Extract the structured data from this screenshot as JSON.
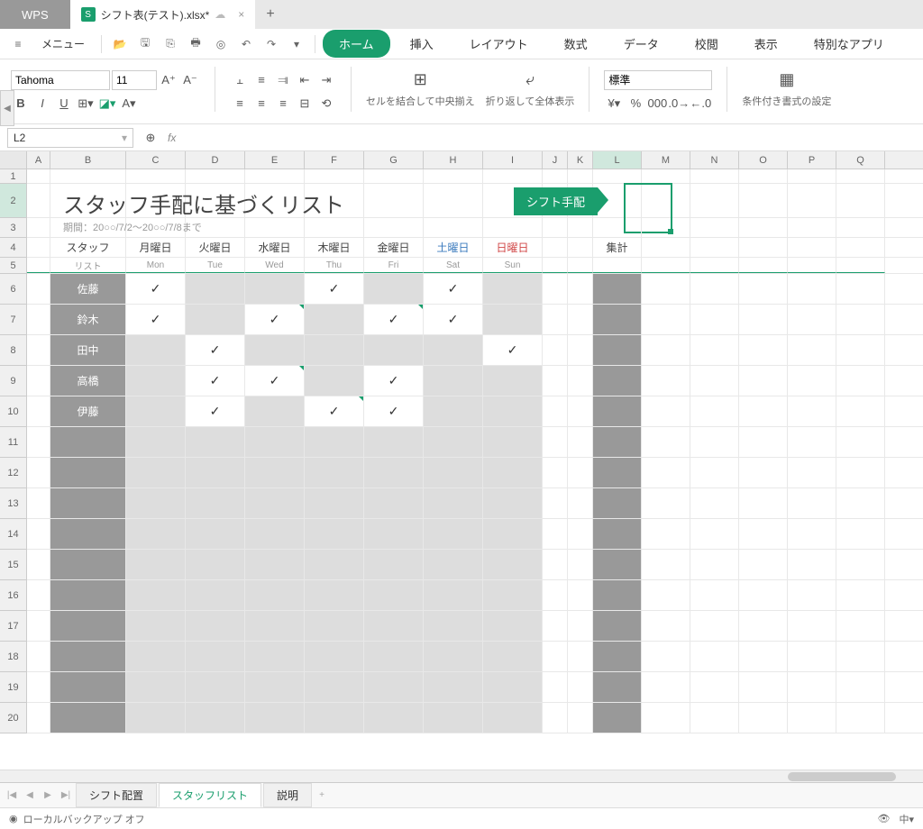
{
  "app": {
    "name": "WPS"
  },
  "document": {
    "name": "シフト表(テスト).xlsx*",
    "cloud_icon": "☁"
  },
  "menu": {
    "label": "メニュー"
  },
  "tabs": {
    "home": "ホーム",
    "insert": "挿入",
    "layout": "レイアウト",
    "formula": "数式",
    "data": "データ",
    "review": "校閲",
    "view": "表示",
    "special": "特別なアプリ"
  },
  "ribbon": {
    "font_name": "Tahoma",
    "font_size": "11",
    "merge_label": "セルを結合して中央揃え",
    "wrap_label": "折り返して全体表示",
    "format_value": "標準",
    "cond_fmt": "条件付き書式の設定"
  },
  "namebox": {
    "value": "L2",
    "fx": "fx"
  },
  "cols": [
    "A",
    "B",
    "C",
    "D",
    "E",
    "F",
    "G",
    "H",
    "I",
    "J",
    "K",
    "L",
    "M",
    "N",
    "O",
    "P",
    "Q"
  ],
  "sheet": {
    "title": "スタッフ手配に基づくリスト",
    "subtitle": "期間：20○○/7/2～20○○/7/8まで",
    "shift_btn": "シフト手配",
    "staff_hdr1": "スタッフ",
    "staff_hdr2": "リスト",
    "total_hdr": "集計",
    "days": [
      {
        "jp": "月曜日",
        "en": "Mon"
      },
      {
        "jp": "火曜日",
        "en": "Tue"
      },
      {
        "jp": "水曜日",
        "en": "Wed"
      },
      {
        "jp": "木曜日",
        "en": "Thu"
      },
      {
        "jp": "金曜日",
        "en": "Fri"
      },
      {
        "jp": "土曜日",
        "en": "Sat",
        "cls": "sat"
      },
      {
        "jp": "日曜日",
        "en": "Sun",
        "cls": "sun"
      }
    ],
    "staff": [
      {
        "name": "佐藤",
        "marks": [
          "✓",
          "",
          "",
          "✓",
          "",
          "✓",
          ""
        ]
      },
      {
        "name": "鈴木",
        "marks": [
          "✓",
          "",
          "✓",
          "",
          "✓",
          "✓",
          ""
        ]
      },
      {
        "name": "田中",
        "marks": [
          "",
          "✓",
          "",
          "",
          "",
          "",
          "✓"
        ]
      },
      {
        "name": "高橋",
        "marks": [
          "",
          "✓",
          "✓",
          "",
          "✓",
          "",
          ""
        ]
      },
      {
        "name": "伊藤",
        "marks": [
          "",
          "✓",
          "",
          "✓",
          "✓",
          "",
          ""
        ]
      }
    ],
    "triangles": [
      [
        1,
        2
      ],
      [
        1,
        4
      ],
      [
        3,
        2
      ],
      [
        4,
        3
      ]
    ]
  },
  "sheet_tabs": [
    "シフト配置",
    "スタッフリスト",
    "説明"
  ],
  "status": {
    "backup": "ローカルバックアップ オフ"
  }
}
